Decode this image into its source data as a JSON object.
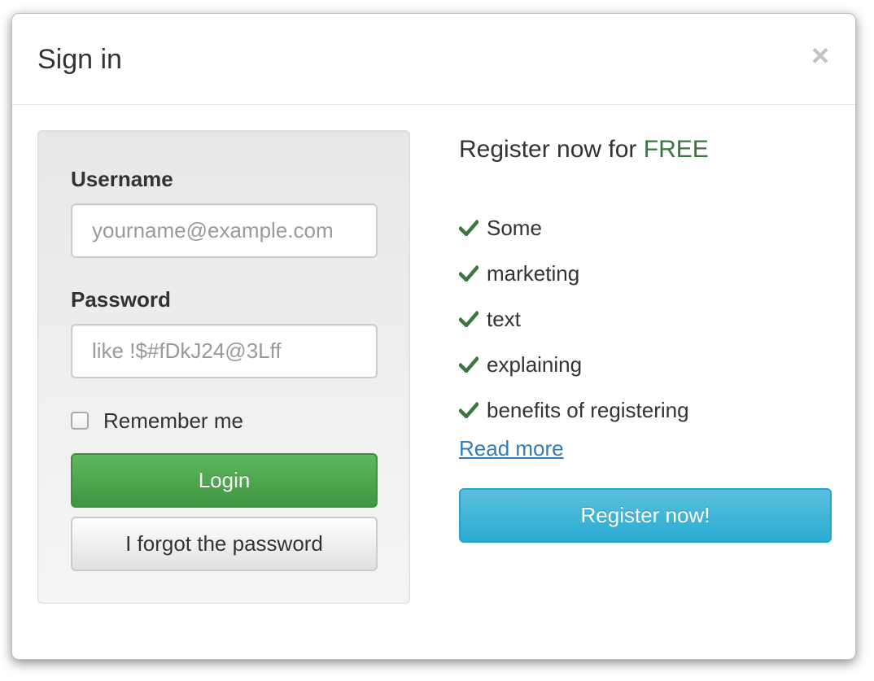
{
  "modal": {
    "title": "Sign in",
    "close_glyph": "×",
    "close_icon": "close-icon"
  },
  "login": {
    "username_label": "Username",
    "username_placeholder": "yourname@example.com",
    "username_value": "",
    "password_label": "Password",
    "password_placeholder": "like !$#fDkJ24@3Lff",
    "password_value": "",
    "remember_label": "Remember me",
    "remember_checked": false,
    "login_button": "Login",
    "forgot_button": "I forgot the password"
  },
  "register": {
    "heading_prefix": "Register now for ",
    "heading_emphasis": "FREE",
    "benefits": [
      {
        "label": "Some",
        "icon": "checkmark-icon"
      },
      {
        "label": "marketing",
        "icon": "checkmark-icon"
      },
      {
        "label": "text",
        "icon": "checkmark-icon"
      },
      {
        "label": "explaining",
        "icon": "checkmark-icon"
      },
      {
        "label": "benefits of registering",
        "icon": "checkmark-icon"
      }
    ],
    "read_more_link": "Read more",
    "register_button": "Register now!"
  },
  "colors": {
    "free_text": "#3c763d",
    "checkmark": "#3c763d",
    "login_button": "#5cb85c",
    "register_button": "#5bc0de",
    "link": "#337ab7"
  }
}
